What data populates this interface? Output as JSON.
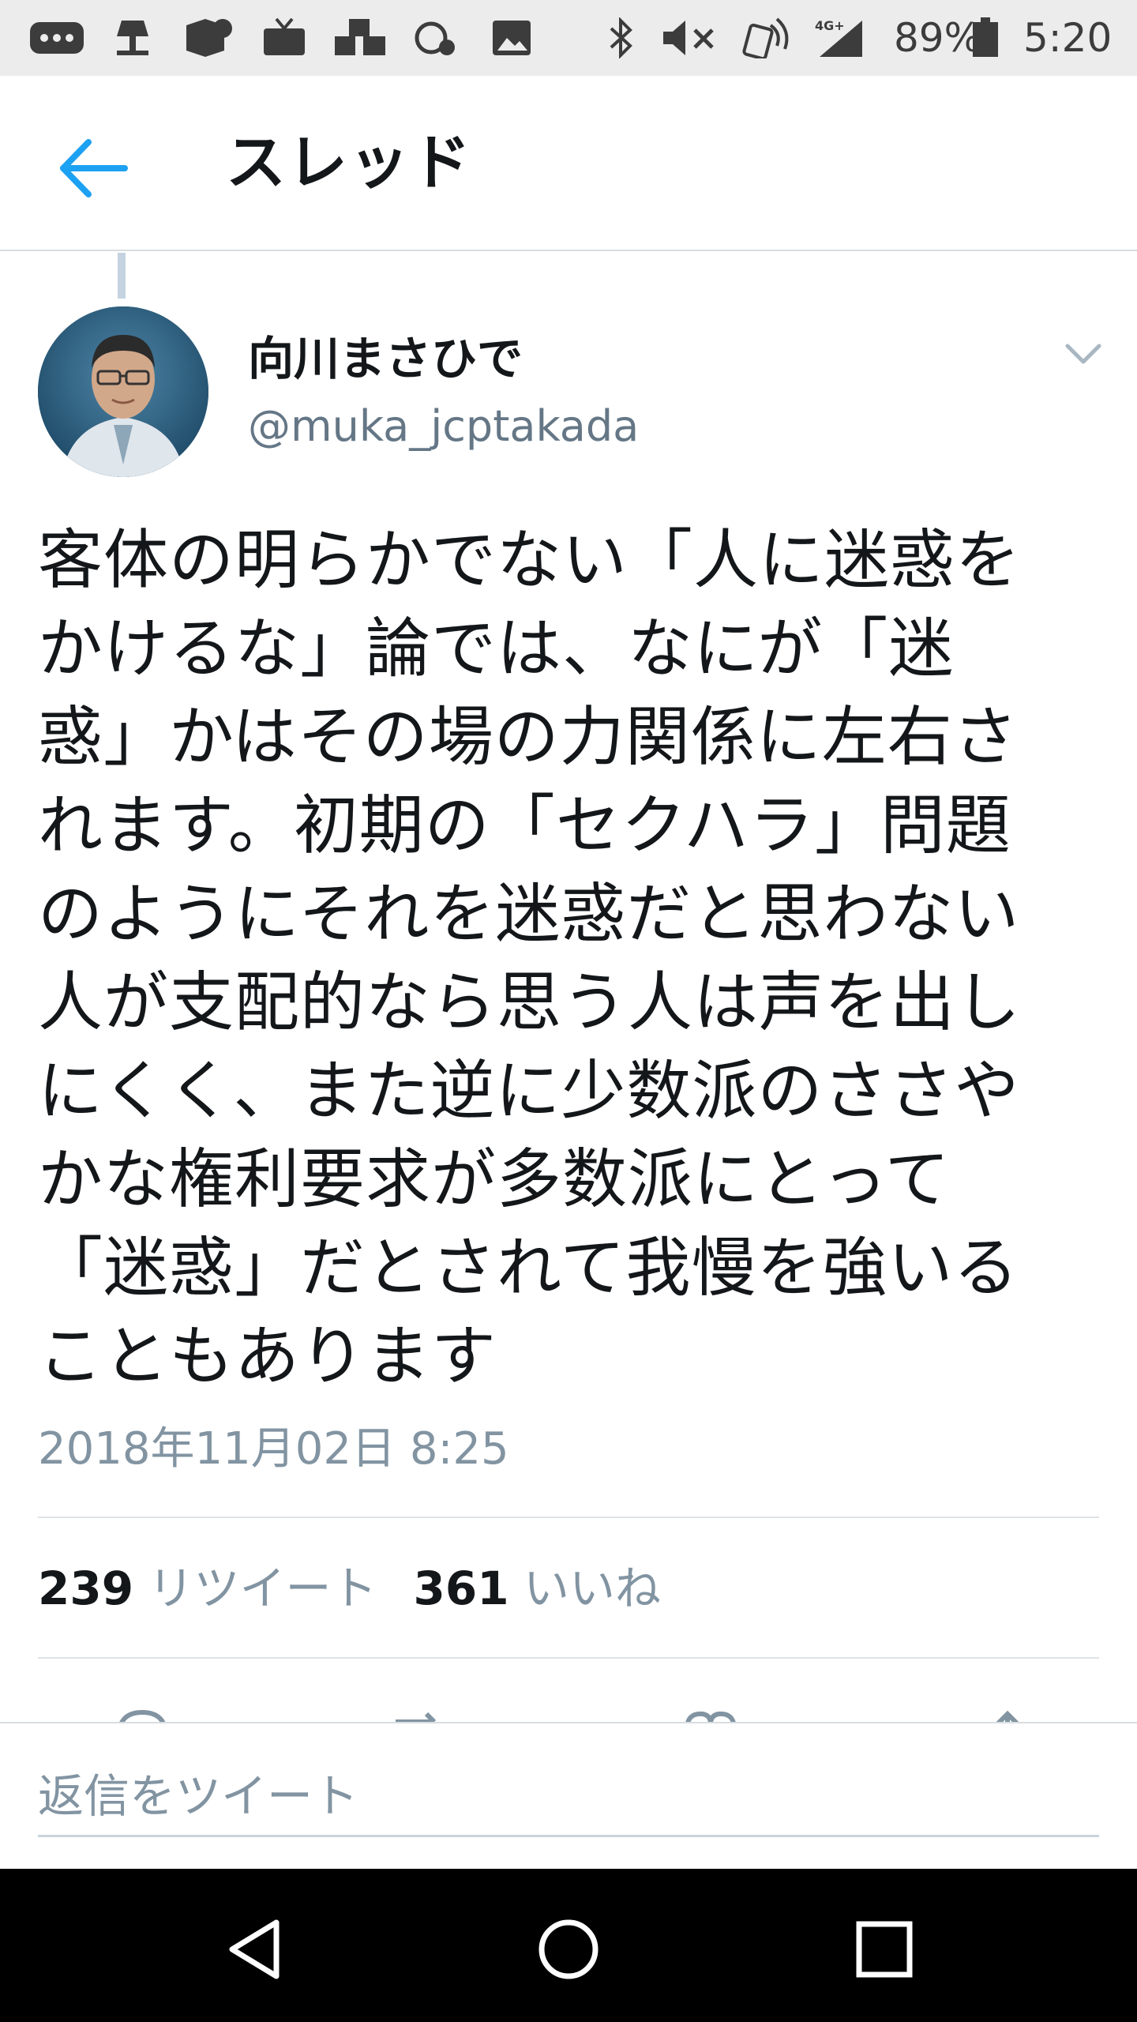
{
  "status_bar": {
    "battery": "89%",
    "time": "5:20",
    "network": "4G+"
  },
  "header": {
    "title": "スレッド",
    "back_icon": "arrow-left-icon"
  },
  "tweet": {
    "name": "向川まさひで",
    "handle": "@muka_jcptakada",
    "text": "客体の明らかでない「人に迷惑を\nかけるな」論では、なにが「迷\n惑」かはその場の力関係に左右さ\nれます。初期の「セクハラ」問題\nのようにそれを迷惑だと思わない\n人が支配的なら思う人は声を出し\nにくく、また逆に少数派のささや\nかな権利要求が多数派にとって\n「迷惑」だとされて我慢を強いる\nこともあります",
    "timestamp": "2018年11月02日 8:25",
    "retweet_count": "239",
    "retweet_label": "リツイート",
    "like_count": "361",
    "like_label": "いいね"
  },
  "reply": {
    "placeholder": "返信をツイート"
  },
  "colors": {
    "accent": "#1da1f2",
    "secondary_text": "#8294a2",
    "nav_bar": "#000000"
  }
}
